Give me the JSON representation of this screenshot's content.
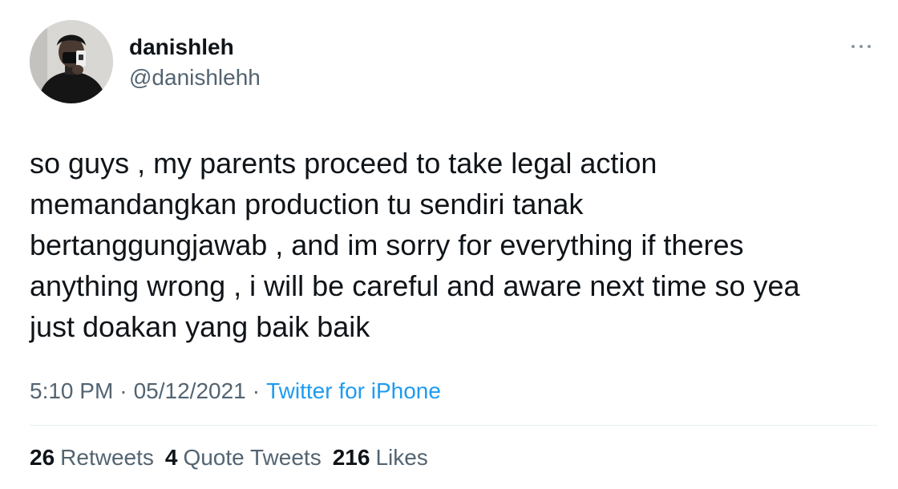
{
  "author": {
    "display_name": "danishleh",
    "handle": "@danishlehh"
  },
  "tweet": {
    "lines": [
      "so guys , my parents proceed to take legal action",
      "memandangkan production tu sendiri tanak",
      "bertanggungjawab , and im sorry for everything if theres",
      "anything wrong , i will be careful and aware next time so yea",
      "just doakan yang baik baik"
    ],
    "time": "5:10 PM",
    "separator": "·",
    "date": "05/12/2021",
    "source": "Twitter for iPhone"
  },
  "stats": {
    "retweets_count": "26",
    "retweets_label": "Retweets",
    "quotes_count": "4",
    "quotes_label": "Quote Tweets",
    "likes_count": "216",
    "likes_label": "Likes"
  },
  "icons": {
    "more": "more-horizontal-icon",
    "avatar": "profile-photo"
  },
  "colors": {
    "text_primary": "#0f1419",
    "text_secondary": "#536471",
    "link": "#1d9bf0",
    "divider": "#e6ecf0"
  }
}
